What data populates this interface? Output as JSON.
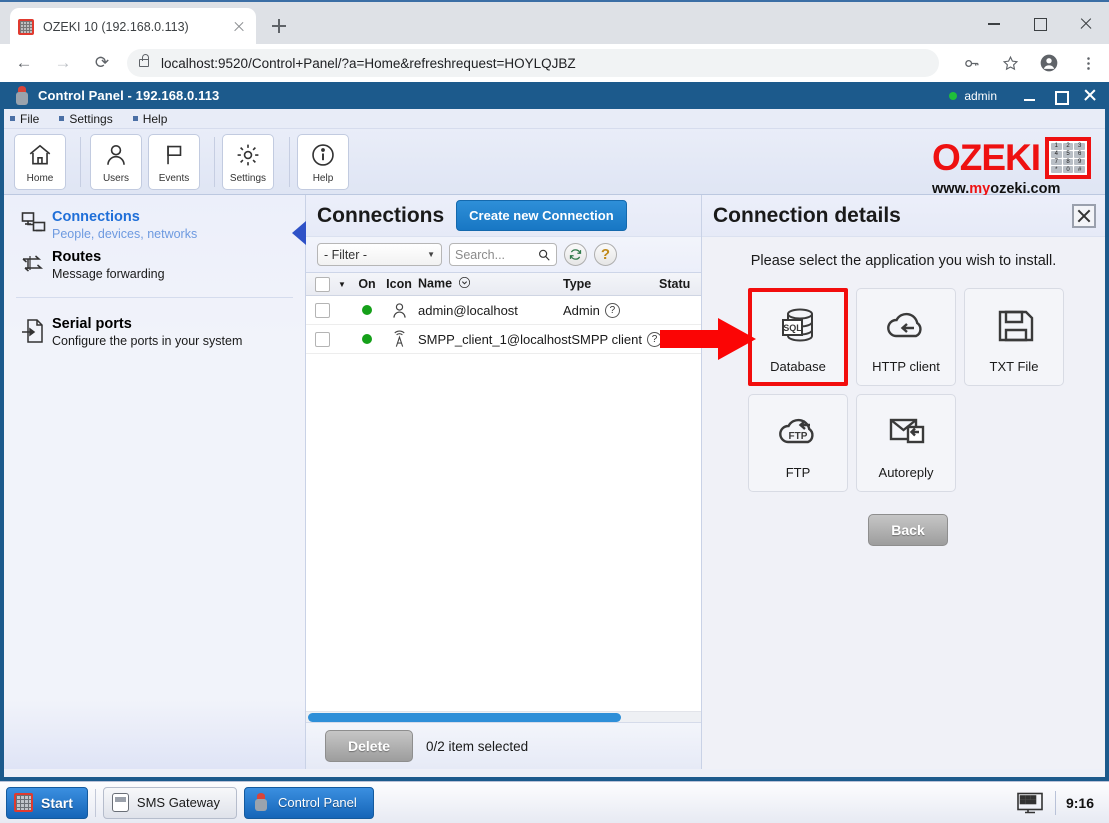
{
  "browser": {
    "tab": {
      "title": "OZEKI 10 (192.168.0.113)",
      "favicon": "ozeki-grid-icon",
      "close": "×"
    },
    "new_tab_label": "+",
    "nav": {
      "back": "←",
      "forward": "→",
      "reload": "⟳"
    },
    "url": "localhost:9520/Control+Panel/?a=Home&refreshrequest=HOYLQJBZ",
    "omnibox_icons": [
      "key-icon",
      "star-icon",
      "profile-icon",
      "menu-kebab-icon"
    ],
    "window_controls": [
      "minimize",
      "maximize",
      "close"
    ]
  },
  "app": {
    "title": "Control Panel - 192.168.0.113",
    "user": "admin",
    "menu": [
      {
        "label": "File"
      },
      {
        "label": "Settings"
      },
      {
        "label": "Help"
      }
    ],
    "ribbon": [
      {
        "label": "Home",
        "icon": "home-icon"
      },
      {
        "label": "Users",
        "icon": "user-icon"
      },
      {
        "label": "Events",
        "icon": "flag-icon"
      },
      {
        "label": "Settings",
        "icon": "gear-icon"
      },
      {
        "label": "Help",
        "icon": "info-icon"
      }
    ],
    "logo": {
      "wordmark": "OZEKI",
      "url_w": "www.",
      "url_my": "my",
      "url_oz": "ozeki.com",
      "keypad": [
        "1",
        "2",
        "3",
        "4",
        "5",
        "6",
        "7",
        "8",
        "9",
        "*",
        "0",
        "#"
      ],
      "color": "#ee1111"
    }
  },
  "sidebar": {
    "items": [
      {
        "title": "Connections",
        "subtitle": "People, devices, networks",
        "icon": "devices-icon",
        "active": true
      },
      {
        "title": "Routes",
        "subtitle": "Message forwarding",
        "icon": "routes-icon",
        "active": false
      },
      {
        "title": "Serial ports",
        "subtitle": "Configure the ports in your system",
        "icon": "serialport-icon",
        "active": false
      }
    ]
  },
  "connections": {
    "title": "Connections",
    "create_button": "Create new Connection",
    "filter_value": "- Filter -",
    "search_placeholder": "Search...",
    "refresh_icon": "refresh-icon",
    "help_icon": "question-icon",
    "columns": [
      "On",
      "Icon",
      "Name",
      "Type",
      "Statu"
    ],
    "rows": [
      {
        "on": true,
        "icon": "user-icon",
        "name": "admin@localhost",
        "type": "Admin",
        "has_hint": true
      },
      {
        "on": true,
        "icon": "antenna-icon",
        "name": "SMPP_client_1@localhost",
        "type": "SMPP client",
        "has_hint": true
      }
    ],
    "delete_button": "Delete",
    "selection_text": "0/2 item selected",
    "scrollbar_color": "#2e8fd8"
  },
  "details": {
    "title": "Connection details",
    "close_icon": "close-icon",
    "prompt": "Please select the application you wish to install.",
    "tiles": [
      {
        "label": "Database",
        "icon": "sql-database-icon",
        "selected": true
      },
      {
        "label": "HTTP client",
        "icon": "cloud-http-icon",
        "selected": false
      },
      {
        "label": "TXT File",
        "icon": "floppy-disk-icon",
        "selected": false
      },
      {
        "label": "FTP",
        "icon": "cloud-ftp-icon",
        "selected": false
      },
      {
        "label": "Autoreply",
        "icon": "envelope-reply-icon",
        "selected": false
      }
    ],
    "back_button": "Back",
    "highlight_color": "#f20d0d"
  },
  "taskbar": {
    "start_label": "Start",
    "tasks": [
      {
        "label": "SMS Gateway",
        "icon": "phone-icon",
        "active": false
      },
      {
        "label": "Control Panel",
        "icon": "ozeki-robot-icon",
        "active": true
      }
    ],
    "tray_icon": "monitor-icon",
    "clock": "9:16"
  }
}
